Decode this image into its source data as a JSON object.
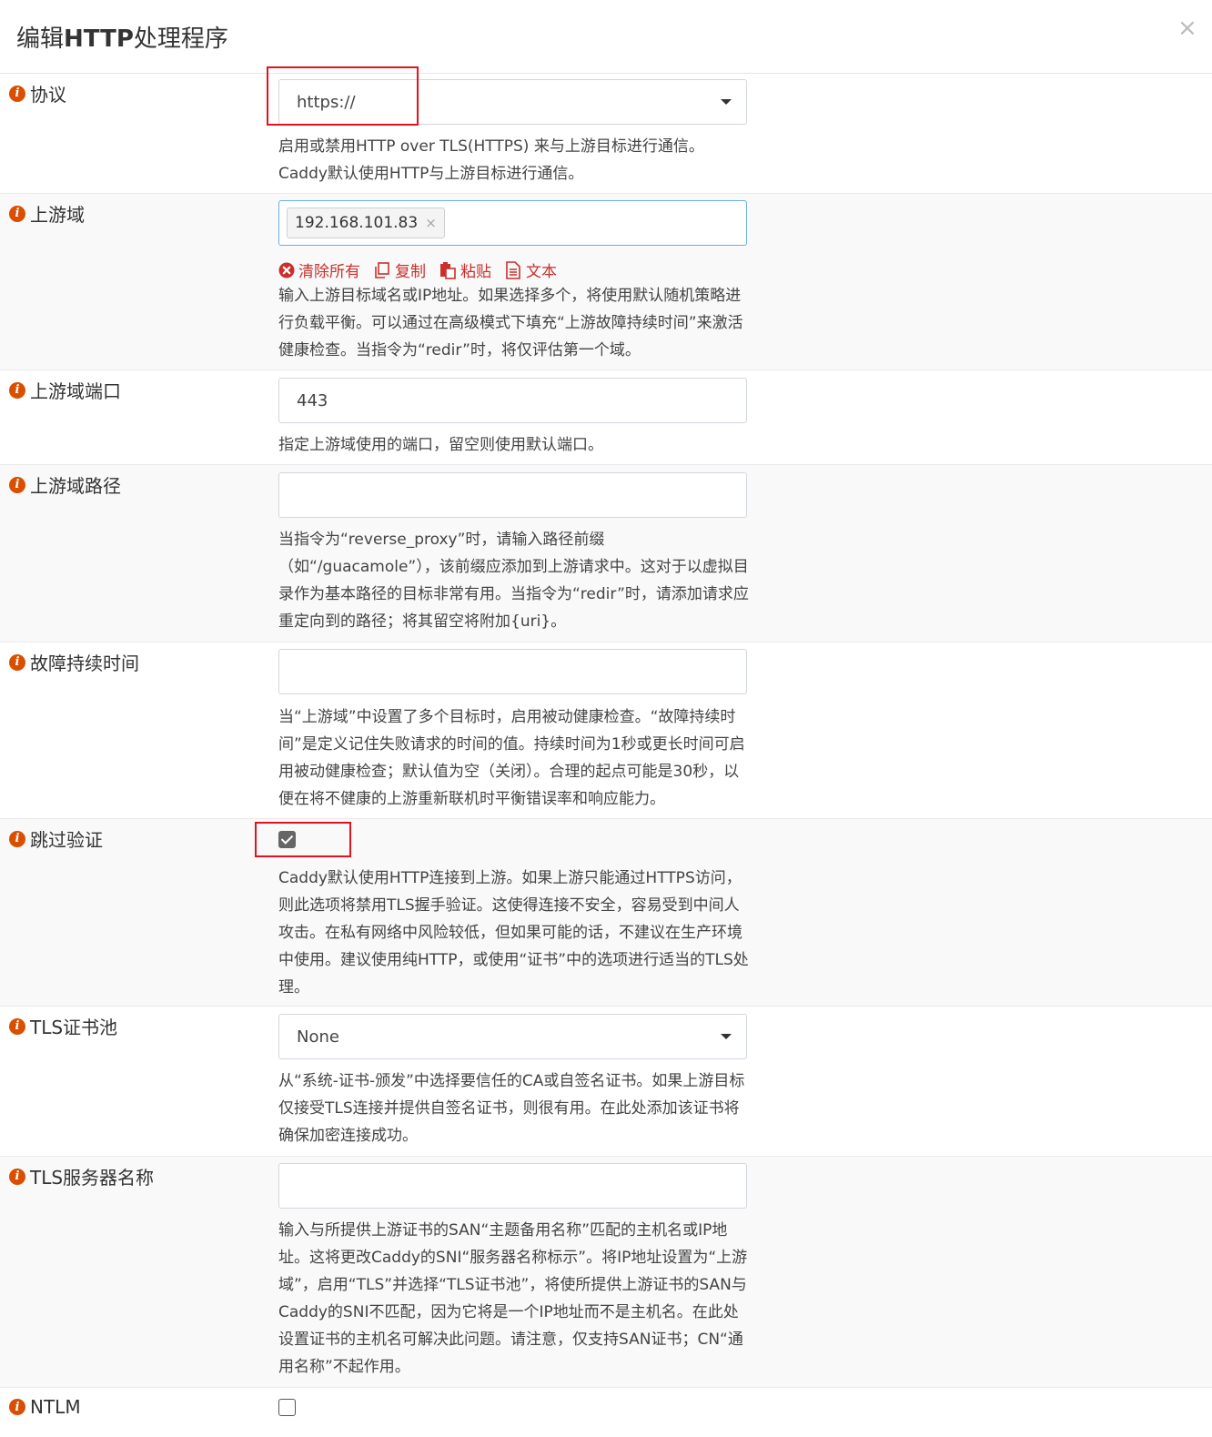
{
  "modal": {
    "title_prefix": "编辑",
    "title_bold": "HTTP",
    "title_suffix": "处理程序",
    "close_glyph": "×"
  },
  "fields": {
    "protocol": {
      "label": "协议",
      "value": "https://",
      "help": "启用或禁用HTTP over TLS(HTTPS) 来与上游目标进行通信。Caddy默认使用HTTP与上游目标进行通信。"
    },
    "upstream_domain": {
      "label": "上游域",
      "tag": "192.168.101.83",
      "tag_remove": "×",
      "actions": {
        "clear_all": "清除所有",
        "copy": "复制",
        "paste": "粘贴",
        "text": "文本"
      },
      "help": "输入上游目标域名或IP地址。如果选择多个，将使用默认随机策略进行负载平衡。可以通过在高级模式下填充“上游故障持续时间”来激活健康检查。当指令为“redir”时，将仅评估第一个域。"
    },
    "upstream_port": {
      "label": "上游域端口",
      "value": "443",
      "help": "指定上游域使用的端口，留空则使用默认端口。"
    },
    "upstream_path": {
      "label": "上游域路径",
      "value": "",
      "help": "当指令为“reverse_proxy”时，请输入路径前缀（如“/guacamole”），该前缀应添加到上游请求中。这对于以虚拟目录作为基本路径的目标非常有用。当指令为“redir”时，请添加请求应重定向到的路径；将其留空将附加{uri}。"
    },
    "fail_duration": {
      "label": "故障持续时间",
      "value": "",
      "help": "当“上游域”中设置了多个目标时，启用被动健康检查。“故障持续时间”是定义记住失败请求的时间的值。持续时间为1秒或更长时间可启用被动健康检查；默认值为空（关闭）。合理的起点可能是30秒，以便在将不健康的上游重新联机时平衡错误率和响应能力。"
    },
    "skip_verify": {
      "label": "跳过验证",
      "checked": true,
      "help": "Caddy默认使用HTTP连接到上游。如果上游只能通过HTTPS访问，则此选项将禁用TLS握手验证。这使得连接不安全，容易受到中间人攻击。在私有网络中风险较低，但如果可能的话，不建议在生产环境中使用。建议使用纯HTTP，或使用“证书”中的选项进行适当的TLS处理。"
    },
    "tls_pool": {
      "label": "TLS证书池",
      "value": "None",
      "help": "从“系统-证书-颁发”中选择要信任的CA或自签名证书。如果上游目标仅接受TLS连接并提供自签名证书，则很有用。在此处添加该证书将确保加密连接成功。"
    },
    "tls_server_name": {
      "label": "TLS服务器名称",
      "value": "",
      "help": "输入与所提供上游证书的SAN“主题备用名称”匹配的主机名或IP地址。这将更改Caddy的SNI“服务器名称标示”。将IP地址设置为“上游域”，启用“TLS”并选择“TLS证书池”，将使所提供上游证书的SAN与Caddy的SNI不匹配，因为它将是一个IP地址而不是主机名。在此处设置证书的主机名可解决此问题。请注意，仅支持SAN证书；CN“通用名称”不起作用。"
    },
    "ntlm": {
      "label": "NTLM",
      "checked": false
    }
  },
  "colors": {
    "info_icon": "#d94f00",
    "highlight_box": "#e0141e",
    "action_link": "#c9302c"
  }
}
